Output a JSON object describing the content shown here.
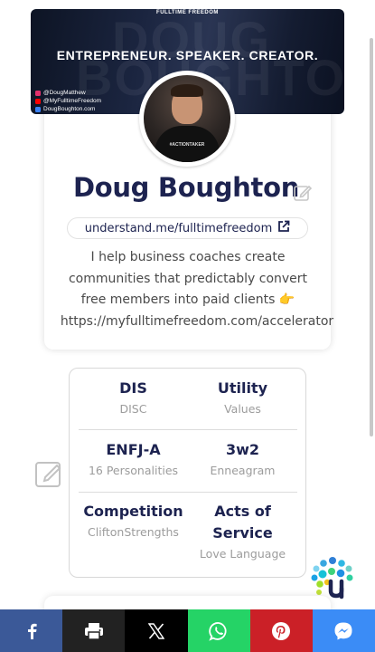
{
  "banner": {
    "brand": "FULLTIME FREEDOM",
    "tagline": "ENTREPRENEUR. SPEAKER. CREATOR.",
    "ghost_text_1": "DOUG",
    "ghost_text_2": "BOUGHTON",
    "socials": [
      {
        "icon": "instagram-icon",
        "color": "#e1306c",
        "text": "@DougMatthew"
      },
      {
        "icon": "youtube-icon",
        "color": "#ff0000",
        "text": "@MyFulltimeFreedom"
      },
      {
        "icon": "web-icon",
        "color": "#3b82f6",
        "text": "DougBoughton.com"
      }
    ]
  },
  "profile": {
    "name": "Doug Boughton",
    "shirt_text": "#ACTIONTAKER",
    "link": "understand.me/fulltimefreedom",
    "bio_lines": [
      "I help business coaches create",
      "communities that predictably convert",
      "free members into paid clients 👉"
    ],
    "bio_url": "https://myfulltimefreedom.com/accelerator"
  },
  "traits": [
    {
      "value": "DIS",
      "label": "DISC"
    },
    {
      "value": "Utility",
      "label": "Values"
    },
    {
      "value": "ENFJ-A",
      "label": "16 Personalities"
    },
    {
      "value": "3w2",
      "label": "Enneagram"
    },
    {
      "value": "Competition",
      "label": "CliftonStrengths"
    },
    {
      "value": "Acts of Service",
      "label": "Love Language"
    }
  ],
  "share_bar": [
    {
      "name": "facebook",
      "icon": "facebook-icon",
      "color": "#3b5998"
    },
    {
      "name": "print",
      "icon": "printer-icon",
      "color": "#222222"
    },
    {
      "name": "x",
      "icon": "x-icon",
      "color": "#000000"
    },
    {
      "name": "whatsapp",
      "icon": "whatsapp-icon",
      "color": "#25d366"
    },
    {
      "name": "pinterest",
      "icon": "pinterest-icon",
      "color": "#cb2027"
    },
    {
      "name": "messenger",
      "icon": "messenger-icon",
      "color": "#3b8cf6"
    }
  ],
  "colors": {
    "name": "#1d2350",
    "muted": "#9c9c9c"
  }
}
